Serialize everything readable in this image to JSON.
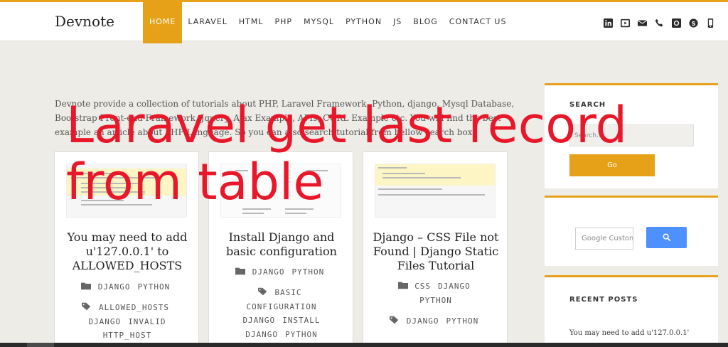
{
  "header": {
    "logo": "Devnote",
    "nav": [
      "HOME",
      "LARAVEL",
      "HTML",
      "PHP",
      "MYSQL",
      "PYTHON",
      "JS",
      "BLOG",
      "CONTACT US"
    ],
    "social_icons": [
      "linkedin-icon",
      "youtube-icon",
      "envelope-icon",
      "phone-icon",
      "github-icon",
      "skype-icon",
      "phone-portrait-icon"
    ]
  },
  "intro": "Devnote provide a collection of tutorials about PHP, Laravel Framework, Python, django, Mysql Database, Bootstrap Front-end Framework, Jquery, Ajax Example, APIs, CURL Example etc. You will find the best example an article about PHP Language. So you can also search tutorial from bellow search box.",
  "overlay_title": "Laravel get last record from table",
  "cards": [
    {
      "title": "You may need to add u'127.0.0.1' to ALLOWED_HOSTS",
      "categories": [
        "DJANGO",
        "PYTHON"
      ],
      "tags": [
        "ALLOWED_HOSTS",
        "DJANGO",
        "INVALID",
        "HTTP_HOST"
      ]
    },
    {
      "title": "Install Django and basic configuration",
      "categories": [
        "DJANGO",
        "PYTHON"
      ],
      "tags": [
        "BASIC",
        "CONFIGURATION",
        "DJANGO",
        "INSTALL",
        "DJANGO",
        "PYTHON"
      ]
    },
    {
      "title": "Django – CSS File not Found | Django Static Files Tutorial",
      "categories": [
        "CSS",
        "DJANGO",
        "PYTHON"
      ],
      "tags": [
        "DJANGO",
        "PYTHON"
      ]
    }
  ],
  "sidebar": {
    "search_title": "SEARCH",
    "search_placeholder": "Search...",
    "go_label": "Go",
    "gcse_placeholder": "Google Custom Search",
    "recent_title": "RECENT POSTS",
    "recent_items": [
      "You may need to add u'127.0.0.1'"
    ]
  },
  "colors": {
    "accent": "#e6a118",
    "overlay_text": "#e8182a",
    "search_button": "#4d90fe"
  }
}
